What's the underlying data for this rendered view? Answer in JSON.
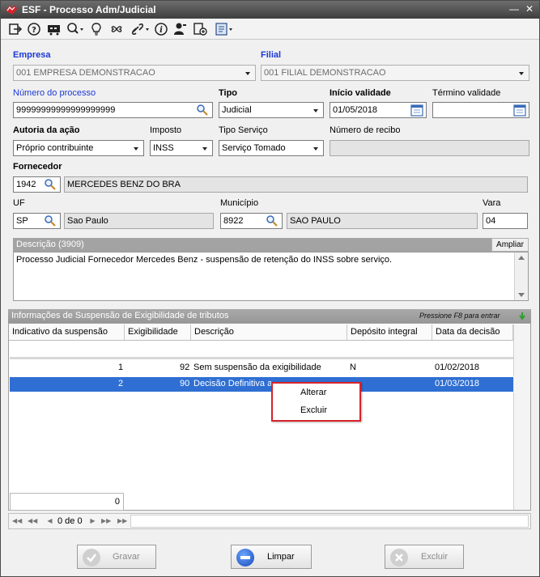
{
  "window": {
    "title": "ESF - Processo Adm/Judicial",
    "brand_color": "#d8232a"
  },
  "toolbar": {
    "icons": [
      "exit-icon",
      "help-icon",
      "cart-icon",
      "search-icon",
      "lightbulb-icon",
      "clover-icon",
      "link-icon",
      "info-icon",
      "user-icon",
      "document-icon",
      "report-icon"
    ]
  },
  "form": {
    "empresa": {
      "label": "Empresa",
      "value": "001 EMPRESA DEMONSTRACAO"
    },
    "filial": {
      "label": "Filial",
      "value": "001 FILIAL DEMONSTRACAO"
    },
    "numero_processo": {
      "label": "Número do processo",
      "value": "99999999999999999999"
    },
    "tipo": {
      "label": "Tipo",
      "value": "Judicial"
    },
    "inicio_validade": {
      "label": "Início validade",
      "value": "01/05/2018"
    },
    "termino_validade": {
      "label": "Término validade",
      "value": ""
    },
    "autoria": {
      "label": "Autoria da ação",
      "value": "Próprio contribuinte"
    },
    "imposto": {
      "label": "Imposto",
      "value": "INSS"
    },
    "tipo_servico": {
      "label": "Tipo Serviço",
      "value": "Serviço Tomado"
    },
    "numero_recibo": {
      "label": "Número de recibo",
      "value": ""
    },
    "fornecedor": {
      "label": "Fornecedor",
      "code": "1942",
      "name": "MERCEDES BENZ DO BRA"
    },
    "uf": {
      "label": "UF",
      "code": "SP",
      "name": "Sao Paulo"
    },
    "municipio": {
      "label": "Município",
      "code": "8922",
      "name": "SAO PAULO"
    },
    "vara": {
      "label": "Vara",
      "value": "04"
    },
    "descricao": {
      "label": "Descrição (3909)",
      "expand_label": "Ampliar",
      "value": "Processo Judicial Fornecedor Mercedes Benz - suspensão de retenção do INSS sobre serviço."
    }
  },
  "suspension": {
    "title": "Informações de Suspensão de Exigibilidade de tributos",
    "hint": "Pressione F8 para entrar",
    "columns": [
      "Indicativo da suspensão",
      "Exigibilidade",
      "Descrição",
      "Depósito integral",
      "Data da decisão"
    ],
    "rows": [
      {
        "indicativo": "1",
        "exigibilidade": "92",
        "descricao": "Sem suspensão da exigibilidade",
        "deposito": "N",
        "data": "01/02/2018"
      },
      {
        "indicativo": "2",
        "exigibilidade": "90",
        "descricao": "Decisão Definitiva a",
        "deposito": "",
        "data": "01/03/2018"
      }
    ],
    "total": "0",
    "pager": "0 de 0"
  },
  "context_menu": {
    "items": [
      "Alterar",
      "Excluir"
    ]
  },
  "buttons": {
    "gravar": "Gravar",
    "limpar": "Limpar",
    "excluir": "Excluir"
  }
}
